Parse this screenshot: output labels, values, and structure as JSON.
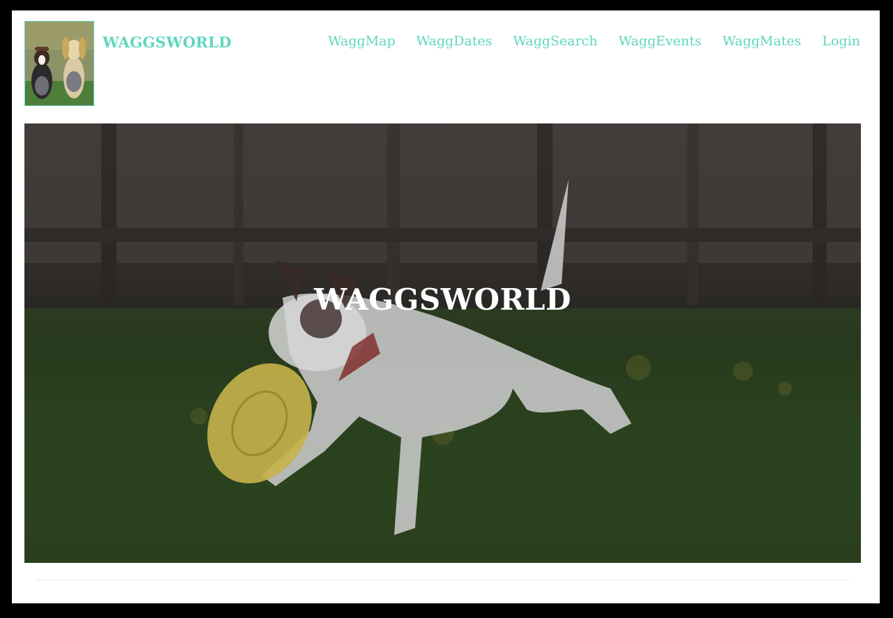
{
  "header": {
    "brand": "WAGGSWORLD",
    "logo_icon": "two-dogs-photo-icon",
    "nav": [
      {
        "label": "WaggMap"
      },
      {
        "label": "WaggDates"
      },
      {
        "label": "WaggSearch"
      },
      {
        "label": "WaggEvents"
      },
      {
        "label": "WaggMates"
      },
      {
        "label": "Login"
      }
    ]
  },
  "hero": {
    "title": "WAGGSWORLD",
    "image_icon": "dog-with-frisbee-photo-icon"
  },
  "colors": {
    "accent": "#5fd6be",
    "page_background": "#ffffff",
    "outer_background": "#000000",
    "hero_title": "#ffffff"
  }
}
